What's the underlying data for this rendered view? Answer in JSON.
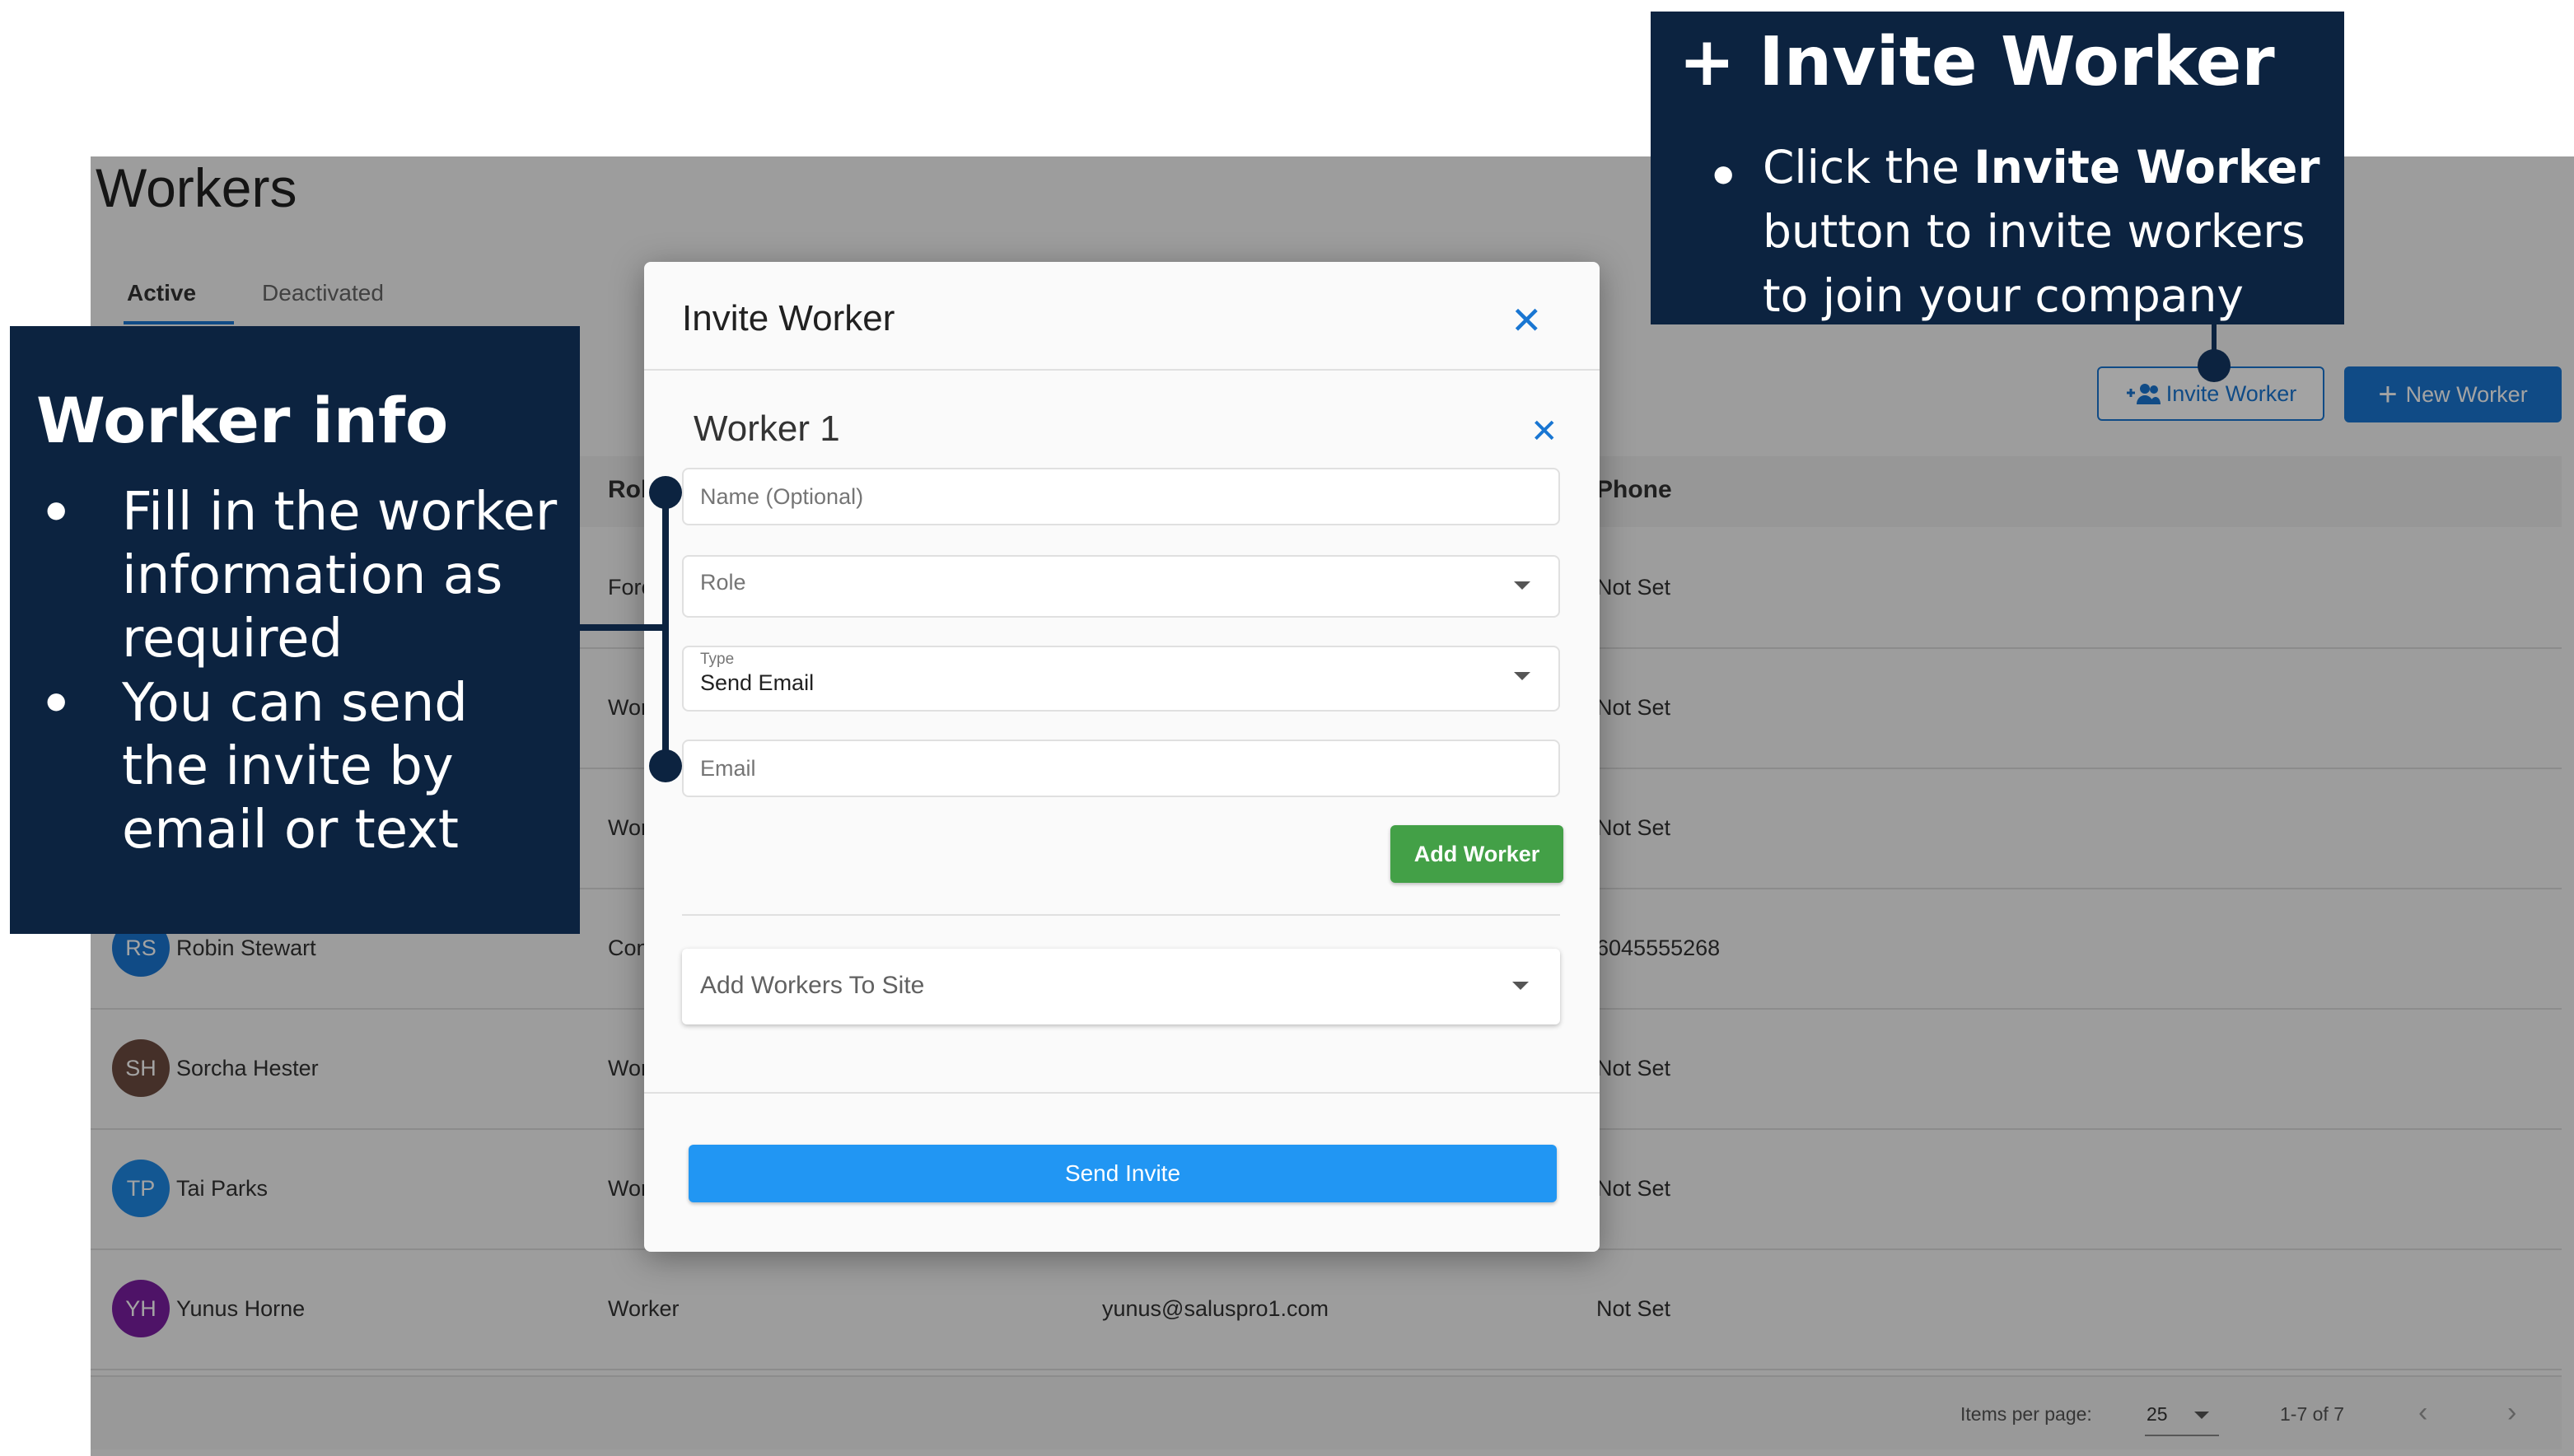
{
  "page": {
    "title": "Workers"
  },
  "tabs": {
    "active": "Active",
    "deactivated": "Deactivated"
  },
  "toolbar": {
    "invite_worker": "Invite Worker",
    "new_worker": "New Worker"
  },
  "table": {
    "headers": {
      "role": "Rol",
      "phone": "Phone"
    },
    "rows": [
      {
        "initials": "",
        "name": "",
        "role": "Fore",
        "email": "",
        "phone": "Not Set",
        "color": ""
      },
      {
        "initials": "",
        "name": "",
        "role": "Wor",
        "email": "",
        "phone": "Not Set",
        "color": ""
      },
      {
        "initials": "",
        "name": "",
        "role": "Wor",
        "email": "",
        "phone": "Not Set",
        "color": ""
      },
      {
        "initials": "RS",
        "name": "Robin Stewart",
        "role": "Con",
        "email": "",
        "phone": "6045555268",
        "color": "#1976d2"
      },
      {
        "initials": "SH",
        "name": "Sorcha Hester",
        "role": "Wor",
        "email": "",
        "phone": "Not Set",
        "color": "#6d4c41"
      },
      {
        "initials": "TP",
        "name": "Tai Parks",
        "role": "Wor",
        "email": "",
        "phone": "Not Set",
        "color": "#1e88e5"
      },
      {
        "initials": "YH",
        "name": "Yunus Horne",
        "role": "Worker",
        "email": "yunus@saluspro1.com",
        "phone": "Not Set",
        "color": "#7b1fa2"
      }
    ]
  },
  "pagination": {
    "items_per_page_label": "Items per page:",
    "items_per_page": "25",
    "range": "1-7 of 7"
  },
  "dialog": {
    "title": "Invite Worker",
    "worker_heading": "Worker 1",
    "name_placeholder": "Name (Optional)",
    "role_placeholder": "Role",
    "type_label": "Type",
    "type_value": "Send Email",
    "email_placeholder": "Email",
    "add_worker": "Add Worker",
    "add_to_site": "Add Workers To Site",
    "send_invite": "Send Invite"
  },
  "callouts": {
    "invite": {
      "title": "+ Invite Worker",
      "text_prefix": "Click the ",
      "text_bold": "Invite Worker",
      "text_suffix": " button to invite workers to join your company"
    },
    "worker_info": {
      "title": "Worker info",
      "bullet1": "Fill in the worker information as required",
      "bullet2": "You can send the invite by email or text"
    }
  },
  "colors": {
    "accent": "#1976d2",
    "callout_bg": "#0c2340",
    "success": "#43a047",
    "send": "#2196f3"
  }
}
